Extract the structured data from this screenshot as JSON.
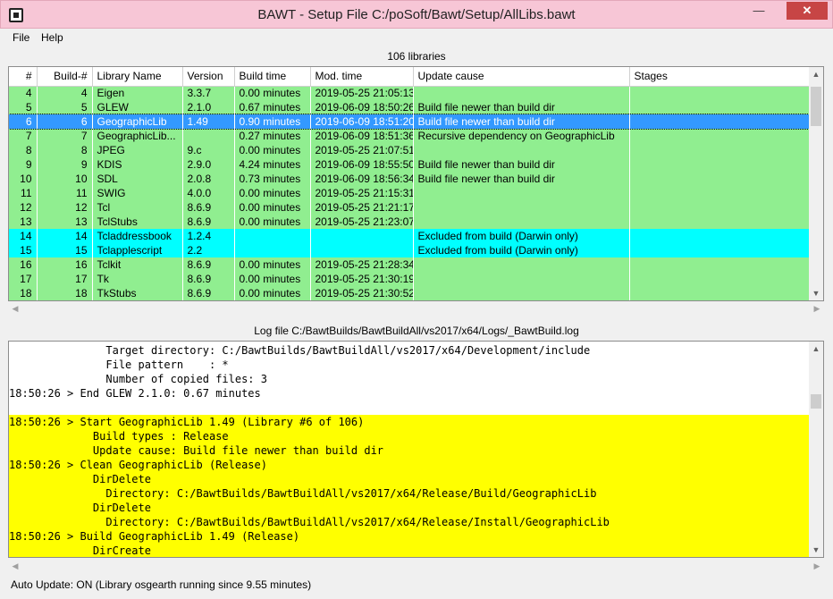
{
  "window": {
    "title": "BAWT - Setup File C:/poSoft/Bawt/Setup/AllLibs.bawt",
    "min": "—",
    "max": "☐",
    "close": "✕"
  },
  "menu": {
    "file": "File",
    "help": "Help"
  },
  "library_count": "106 libraries",
  "table": {
    "columns": [
      "#",
      "Build-#",
      "Library Name",
      "Version",
      "Build time",
      "Mod. time",
      "Update cause",
      "Stages"
    ],
    "rows": [
      {
        "n": "4",
        "b": "4",
        "name": "Eigen",
        "ver": "3.3.7",
        "bt": "0.00 minutes",
        "mt": "2019-05-25 21:05:13",
        "cause": "",
        "stages": "",
        "state": "green"
      },
      {
        "n": "5",
        "b": "5",
        "name": "GLEW",
        "ver": "2.1.0",
        "bt": "0.67 minutes",
        "mt": "2019-06-09 18:50:26",
        "cause": "Build file newer than build dir",
        "stages": "",
        "state": "green"
      },
      {
        "n": "6",
        "b": "6",
        "name": "GeographicLib",
        "ver": "1.49",
        "bt": "0.90 minutes",
        "mt": "2019-06-09 18:51:20",
        "cause": "Build file newer than build dir",
        "stages": "",
        "state": "selected"
      },
      {
        "n": "7",
        "b": "7",
        "name": "GeographicLib...",
        "ver": "",
        "bt": "0.27 minutes",
        "mt": "2019-06-09 18:51:36",
        "cause": "Recursive dependency on GeographicLib",
        "stages": "",
        "state": "green"
      },
      {
        "n": "8",
        "b": "8",
        "name": "JPEG",
        "ver": "9.c",
        "bt": "0.00 minutes",
        "mt": "2019-05-25 21:07:51",
        "cause": "",
        "stages": "",
        "state": "green"
      },
      {
        "n": "9",
        "b": "9",
        "name": "KDIS",
        "ver": "2.9.0",
        "bt": "4.24 minutes",
        "mt": "2019-06-09 18:55:50",
        "cause": "Build file newer than build dir",
        "stages": "",
        "state": "green"
      },
      {
        "n": "10",
        "b": "10",
        "name": "SDL",
        "ver": "2.0.8",
        "bt": "0.73 minutes",
        "mt": "2019-06-09 18:56:34",
        "cause": "Build file newer than build dir",
        "stages": "",
        "state": "green"
      },
      {
        "n": "11",
        "b": "11",
        "name": "SWIG",
        "ver": "4.0.0",
        "bt": "0.00 minutes",
        "mt": "2019-05-25 21:15:31",
        "cause": "",
        "stages": "",
        "state": "green"
      },
      {
        "n": "12",
        "b": "12",
        "name": "Tcl",
        "ver": "8.6.9",
        "bt": "0.00 minutes",
        "mt": "2019-05-25 21:21:17",
        "cause": "",
        "stages": "",
        "state": "green"
      },
      {
        "n": "13",
        "b": "13",
        "name": "TclStubs",
        "ver": "8.6.9",
        "bt": "0.00 minutes",
        "mt": "2019-05-25 21:23:07",
        "cause": "",
        "stages": "",
        "state": "green"
      },
      {
        "n": "14",
        "b": "14",
        "name": "Tcladdressbook",
        "ver": "1.2.4",
        "bt": "",
        "mt": "",
        "cause": "Excluded from build (Darwin only)",
        "stages": "",
        "state": "cyan"
      },
      {
        "n": "15",
        "b": "15",
        "name": "Tclapplescript",
        "ver": "2.2",
        "bt": "",
        "mt": "",
        "cause": "Excluded from build (Darwin only)",
        "stages": "",
        "state": "cyan"
      },
      {
        "n": "16",
        "b": "16",
        "name": "Tclkit",
        "ver": "8.6.9",
        "bt": "0.00 minutes",
        "mt": "2019-05-25 21:28:34",
        "cause": "",
        "stages": "",
        "state": "green"
      },
      {
        "n": "17",
        "b": "17",
        "name": "Tk",
        "ver": "8.6.9",
        "bt": "0.00 minutes",
        "mt": "2019-05-25 21:30:19",
        "cause": "",
        "stages": "",
        "state": "green"
      },
      {
        "n": "18",
        "b": "18",
        "name": "TkStubs",
        "ver": "8.6.9",
        "bt": "0.00 minutes",
        "mt": "2019-05-25 21:30:52",
        "cause": "",
        "stages": "",
        "state": "green"
      }
    ]
  },
  "log_label": "Log file C:/BawtBuilds/BawtBuildAll/vs2017/x64/Logs/_BawtBuild.log",
  "log": {
    "lines": [
      {
        "text": "               Target directory: C:/BawtBuilds/BawtBuildAll/vs2017/x64/Development/include",
        "hl": false
      },
      {
        "text": "               File pattern    : *",
        "hl": false
      },
      {
        "text": "               Number of copied files: 3",
        "hl": false
      },
      {
        "text": "18:50:26 > End GLEW 2.1.0: 0.67 minutes",
        "hl": false
      },
      {
        "text": "",
        "hl": false
      },
      {
        "text": "18:50:26 > Start GeographicLib 1.49 (Library #6 of 106)",
        "hl": true
      },
      {
        "text": "             Build types : Release",
        "hl": true
      },
      {
        "text": "             Update cause: Build file newer than build dir",
        "hl": true
      },
      {
        "text": "18:50:26 > Clean GeographicLib (Release)",
        "hl": true
      },
      {
        "text": "             DirDelete",
        "hl": true
      },
      {
        "text": "               Directory: C:/BawtBuilds/BawtBuildAll/vs2017/x64/Release/Build/GeographicLib",
        "hl": true
      },
      {
        "text": "             DirDelete",
        "hl": true
      },
      {
        "text": "               Directory: C:/BawtBuilds/BawtBuildAll/vs2017/x64/Release/Install/GeographicLib",
        "hl": true
      },
      {
        "text": "18:50:26 > Build GeographicLib 1.49 (Release)",
        "hl": true
      },
      {
        "text": "             DirCreate",
        "hl": true
      }
    ]
  },
  "status": "Auto Update: ON (Library osgearth running since 9.55 minutes)",
  "icons": {
    "up": "up-arrow-icon",
    "down": "down-arrow-icon",
    "left": "left-arrow-icon",
    "right": "right-arrow-icon"
  }
}
